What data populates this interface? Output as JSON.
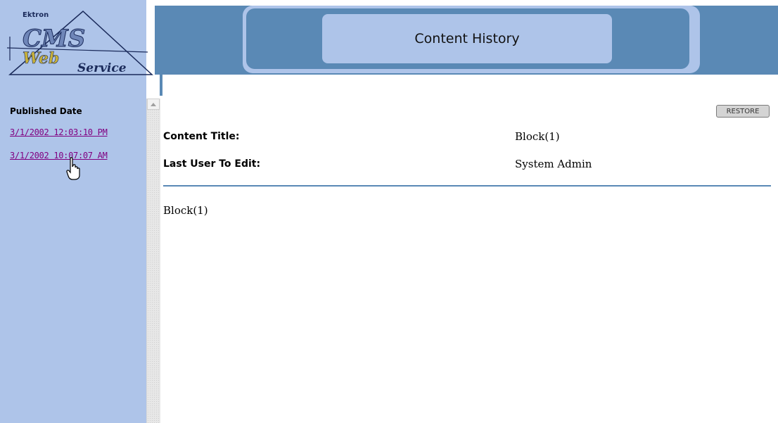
{
  "logo": {
    "brand": "Ektron",
    "line1": "CMS",
    "line2": "Web",
    "line3": "Service"
  },
  "header": {
    "title": "Content History"
  },
  "sidebar": {
    "heading": "Published Date",
    "history": [
      {
        "label": "3/1/2002 12:03:10 PM"
      },
      {
        "label": "3/1/2002 10:07:07 AM"
      }
    ]
  },
  "toolbar": {
    "restore_label": "RESTORE"
  },
  "content": {
    "title_label": "Content Title:",
    "title_value": "Block(1)",
    "last_user_label": "Last User To Edit:",
    "last_user_value": "System Admin",
    "body": "Block(1)"
  },
  "colors": {
    "frame_blue": "#aec4e9",
    "header_blue": "#5a89b5",
    "visited_link": "#800080"
  }
}
